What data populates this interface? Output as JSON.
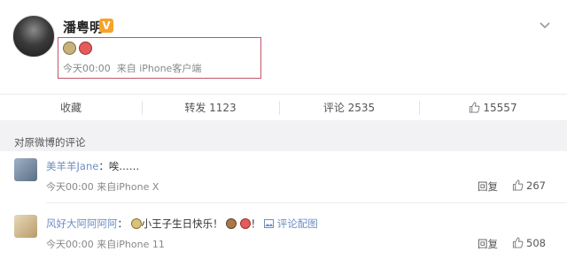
{
  "post": {
    "author": "潘粤明",
    "verified_badge": "V",
    "emojis": [
      "wolf-emoji",
      "hammer-emoji"
    ],
    "time": "今天00:00",
    "source": "来自 iPhone客户端"
  },
  "actions": {
    "favorite": "收藏",
    "repost": "转发 1123",
    "comment": "评论 2535",
    "like_count": "15557"
  },
  "comments_section": {
    "title": "对原微博的评论"
  },
  "comments": [
    {
      "user": "美羊羊Jane",
      "separator": "：",
      "text": "唉……",
      "time": "今天00:00",
      "source": "来自iPhone X",
      "reply_label": "回复",
      "likes": "267"
    },
    {
      "user": "风好大阿阿阿阿",
      "separator": "：",
      "text": "小王子生日快乐！",
      "text_suffix": "！",
      "image_link": "评论配图",
      "time": "今天00:00",
      "source": "来自iPhone 11",
      "reply_label": "回复",
      "likes": "508"
    }
  ],
  "colors": {
    "link": "#6d8fc3",
    "highlight_border": "#c0566a",
    "verified": "#f7a229"
  }
}
